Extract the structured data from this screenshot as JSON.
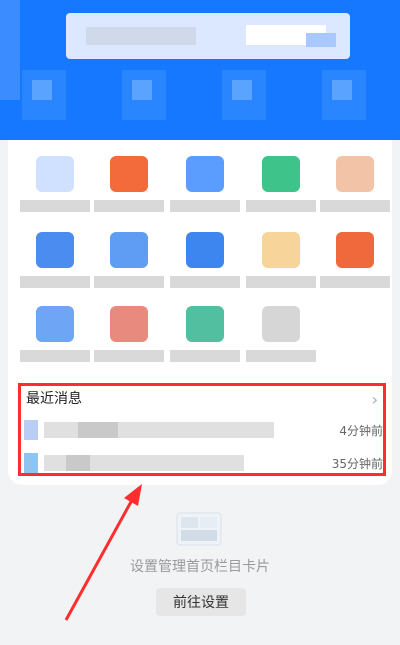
{
  "colors": {
    "header_blue": "#1677ff",
    "annotation_red": "#ff2d2d"
  },
  "recent_messages": {
    "title": "最近消息",
    "items": [
      {
        "time": "4分钟前"
      },
      {
        "time": "35分钟前"
      }
    ]
  },
  "empty_state": {
    "tip": "设置管理首页栏目卡片",
    "button_label": "前往设置"
  }
}
